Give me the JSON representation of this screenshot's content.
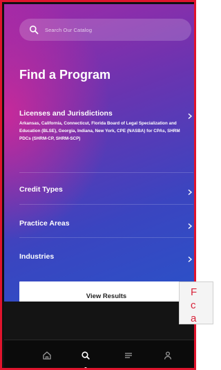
{
  "search": {
    "placeholder": "Search Our Catalog",
    "icon": "search-icon"
  },
  "page_title": "Find a Program",
  "filters": [
    {
      "label": "Licenses and Jurisdictions",
      "description": "Arkansas, California, Connecticut, Florida Board of Legal Specialization and Education (BLSE), Georgia, Indiana, New York, CPE (NASBA) for CPAs, SHRM PDCs (SHRM-CP, SHRM-SCP)"
    },
    {
      "label": "Credit Types"
    },
    {
      "label": "Practice Areas"
    },
    {
      "label": "Industries"
    }
  ],
  "view_results_label": "View Results",
  "bottom_nav": [
    {
      "icon": "home-icon"
    },
    {
      "icon": "search-icon",
      "active": true
    },
    {
      "icon": "menu-icon"
    },
    {
      "icon": "user-icon"
    }
  ],
  "tooltip_lines": [
    "F",
    "c",
    "a"
  ],
  "colors": {
    "frame_border": "#e0142d",
    "gradient_start": "#a12aa8",
    "gradient_end": "#2a52c8",
    "tooltip_text": "#d8233a"
  }
}
